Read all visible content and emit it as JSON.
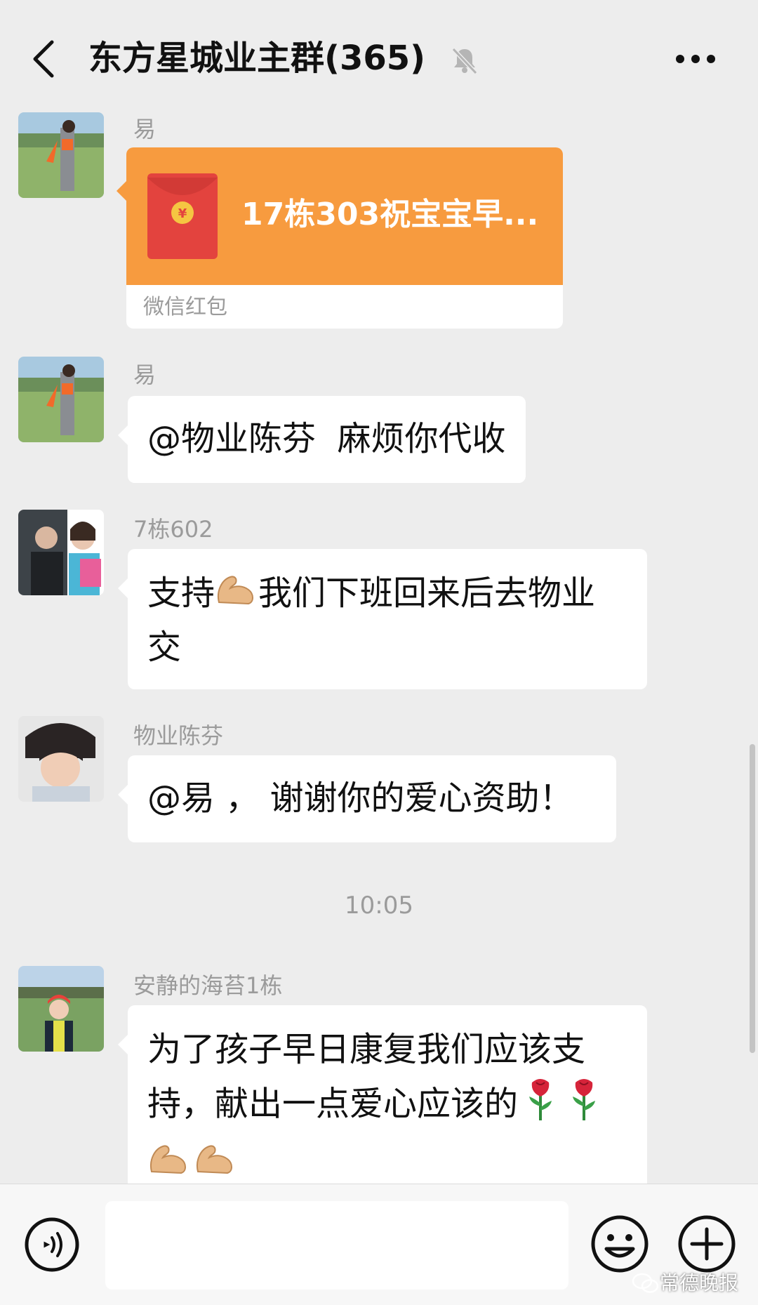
{
  "header": {
    "title": "东方星城业主群(365)"
  },
  "messages": [
    {
      "sender": "易",
      "type": "red_packet",
      "red_packet": {
        "title": "17栋303祝宝宝早...",
        "footer": "微信红包"
      }
    },
    {
      "sender": "易",
      "type": "text",
      "text": "@物业陈芬  麻烦你代收"
    },
    {
      "sender": "7栋602",
      "type": "text",
      "text_line1_a": "支持",
      "text_line1_b": "我们下班回来后去物业",
      "text_line2": "交",
      "emojis": [
        "flexed-biceps"
      ]
    },
    {
      "sender": "物业陈芬",
      "type": "text",
      "text": "@易 ， 谢谢你的爱心资助！"
    },
    {
      "sender": "安静的海苔1栋",
      "type": "text",
      "text_line1": "为了孩子早日康复我们应该支",
      "text_line2": "持，献出一点爱心应该的",
      "emojis": [
        "rose",
        "rose",
        "flexed-biceps",
        "flexed-biceps"
      ]
    }
  ],
  "timestamp": "10:05",
  "input": {
    "value": "",
    "placeholder": ""
  },
  "watermark": "常德晚报",
  "colors": {
    "background": "#ededed",
    "red_packet": "#f79b3f",
    "envelope": "#e3433e",
    "coin": "#f5c542",
    "muted_text": "#9b9b9b"
  }
}
